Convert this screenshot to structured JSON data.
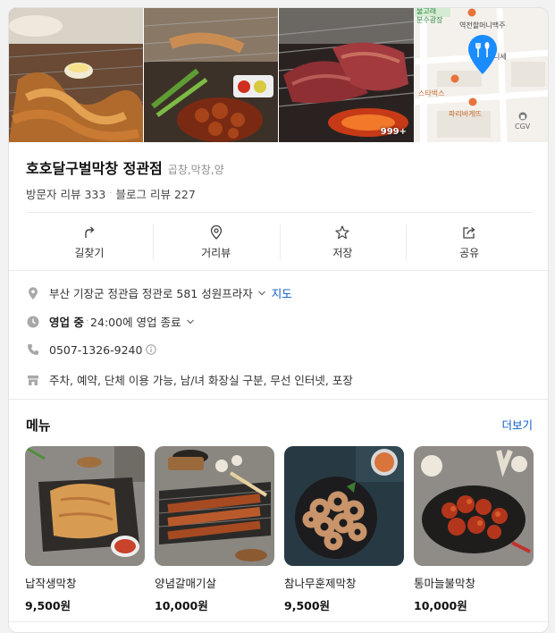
{
  "photos": {
    "more_count": "999+",
    "map_labels": {
      "top_left": "물고래",
      "fountain": "분수광장",
      "restaurant": "역전할머니맥주",
      "shop": "니세",
      "starbucks": "스타벅스",
      "paris": "파리바게뜨",
      "cgv": "CGV"
    }
  },
  "place": {
    "name": "호호달구벌막창 정관점",
    "category": "곱창,막창,양",
    "visitor_reviews": "방문자 리뷰 333",
    "blog_reviews": "블로그 리뷰 227"
  },
  "actions": [
    {
      "label": "길찾기",
      "icon": "directions-icon"
    },
    {
      "label": "거리뷰",
      "icon": "street-view-icon"
    },
    {
      "label": "저장",
      "icon": "star-icon"
    },
    {
      "label": "공유",
      "icon": "share-icon"
    }
  ],
  "info": {
    "address": "부산 기장군 정관읍 정관로 581 성원프라자",
    "map_link": "지도",
    "status": "영업 중",
    "hours": "24:00에 영업 종료",
    "phone": "0507-1326-9240",
    "amenities": "주차, 예약, 단체 이용 가능, 남/녀 화장실 구분, 무선 인터넷, 포장"
  },
  "menu": {
    "heading": "메뉴",
    "more": "더보기",
    "items": [
      {
        "name": "납작생막창",
        "price": "9,500원"
      },
      {
        "name": "양념갈매기살",
        "price": "10,000원"
      },
      {
        "name": "참나무훈제막창",
        "price": "9,500원"
      },
      {
        "name": "통마늘불막창",
        "price": "10,000원"
      }
    ]
  },
  "colors": {
    "link": "#0b5bc7",
    "map_pin": "#1a8cff",
    "poi_orange": "#e8743b"
  }
}
